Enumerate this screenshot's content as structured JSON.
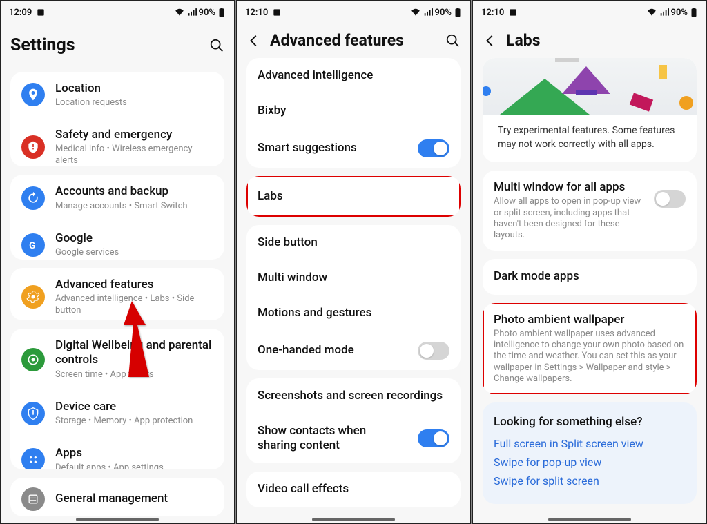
{
  "screen1": {
    "status": {
      "time": "12:09",
      "battery": "90%"
    },
    "title": "Settings",
    "groups": [
      [
        {
          "icon": "location",
          "color": "#2f7ff0",
          "title": "Location",
          "sub": "Location requests"
        },
        {
          "icon": "safety",
          "color": "#d93025",
          "title": "Safety and emergency",
          "sub": "Medical info  •  Wireless emergency alerts"
        }
      ],
      [
        {
          "icon": "backup",
          "color": "#2f7ff0",
          "title": "Accounts and backup",
          "sub": "Manage accounts  •  Smart Switch"
        },
        {
          "icon": "google",
          "color": "#2f7ff0",
          "title": "Google",
          "sub": "Google services"
        }
      ],
      [
        {
          "icon": "advanced",
          "color": "#f0a020",
          "title": "Advanced features",
          "sub": "Advanced intelligence  •  Labs  •  Side button"
        }
      ],
      [
        {
          "icon": "wellbeing",
          "color": "#2c9a3b",
          "title": "Digital Wellbeing and parental controls",
          "sub": "Screen time  •  App timers"
        },
        {
          "icon": "devicecare",
          "color": "#2f7ff0",
          "title": "Device care",
          "sub": "Storage  •  Memory  •  App protection"
        },
        {
          "icon": "apps",
          "color": "#2f7ff0",
          "title": "Apps",
          "sub": "Default apps  •  App settings"
        }
      ],
      [
        {
          "icon": "general",
          "color": "#8a8a8a",
          "title": "General management",
          "sub": ""
        }
      ]
    ]
  },
  "screen2": {
    "status": {
      "time": "12:10",
      "battery": "90%"
    },
    "title": "Advanced features",
    "groups": [
      [
        {
          "title": "Advanced intelligence"
        },
        {
          "title": "Bixby"
        },
        {
          "title": "Smart suggestions",
          "toggle": "on"
        }
      ],
      [
        {
          "title": "Labs",
          "highlight": true
        }
      ],
      [
        {
          "title": "Side button"
        },
        {
          "title": "Multi window"
        },
        {
          "title": "Motions and gestures"
        },
        {
          "title": "One-handed mode",
          "toggle": "off"
        }
      ],
      [
        {
          "title": "Screenshots and screen recordings"
        },
        {
          "title": "Show contacts when sharing content",
          "toggle": "on"
        }
      ],
      [
        {
          "title": "Video call effects"
        }
      ]
    ]
  },
  "screen3": {
    "status": {
      "time": "12:10",
      "battery": "90%"
    },
    "title": "Labs",
    "intro": "Try experimental features. Some features may not work correctly with all apps.",
    "items": [
      {
        "title": "Multi window for all apps",
        "sub": "Allow all apps to open in pop-up view or split screen, including apps that haven't been designed for these layouts.",
        "toggle": "off"
      },
      {
        "title": "Dark mode apps"
      },
      {
        "title": "Photo ambient wallpaper",
        "sub": "Photo ambient wallpaper uses advanced intelligence to change your own photo based on the time and weather. You can set this as your wallpaper in Settings > Wallpaper and style > Change wallpapers.",
        "highlight": true
      }
    ],
    "looking": {
      "title": "Looking for something else?",
      "links": [
        "Full screen in Split screen view",
        "Swipe for pop-up view",
        "Swipe for split screen"
      ]
    }
  }
}
